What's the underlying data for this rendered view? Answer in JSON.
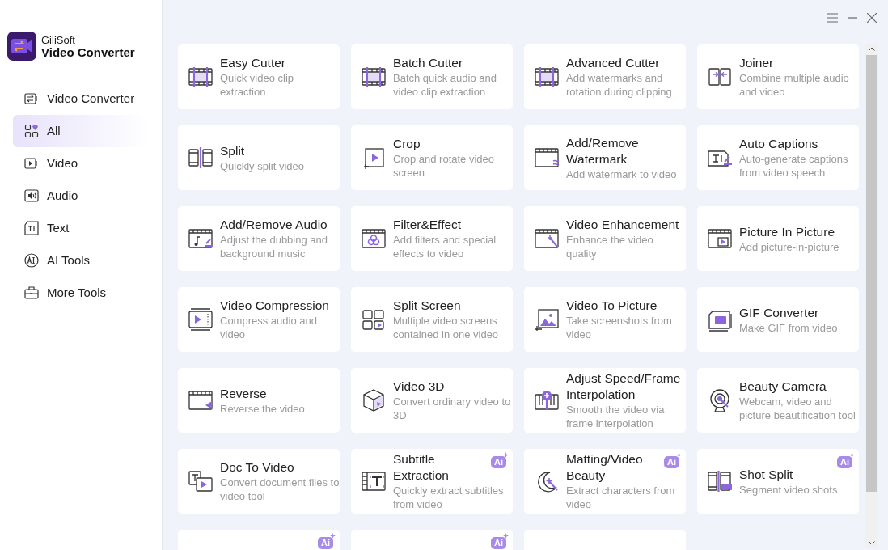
{
  "app": {
    "brand": "GiliSoft",
    "product": "Video Converter"
  },
  "sidebar": {
    "items": [
      {
        "label": "Video Converter",
        "selected": false
      },
      {
        "label": "All",
        "selected": true
      },
      {
        "label": "Video",
        "selected": false
      },
      {
        "label": "Audio",
        "selected": false
      },
      {
        "label": "Text",
        "selected": false
      },
      {
        "label": "AI Tools",
        "selected": false
      },
      {
        "label": "More Tools",
        "selected": false
      }
    ]
  },
  "tools": [
    {
      "title": "Easy Cutter",
      "description": "Quick video clip extraction"
    },
    {
      "title": "Batch Cutter",
      "description": "Batch quick audio and video clip extraction"
    },
    {
      "title": "Advanced Cutter",
      "description": "Add watermarks and rotation during clipping"
    },
    {
      "title": "Joiner",
      "description": "Combine multiple audio and video"
    },
    {
      "title": "Split",
      "description": "Quickly split video"
    },
    {
      "title": "Crop",
      "description": "Crop and rotate video screen"
    },
    {
      "title": "Add/Remove Watermark",
      "description": "Add watermark to video"
    },
    {
      "title": "Auto Captions",
      "description": "Auto-generate captions from video speech"
    },
    {
      "title": "Add/Remove Audio",
      "description": "Adjust the dubbing and background music"
    },
    {
      "title": "Filter&Effect",
      "description": "Add filters and special effects to video"
    },
    {
      "title": "Video Enhancement",
      "description": "Enhance the video quality"
    },
    {
      "title": "Picture In Picture",
      "description": "Add picture-in-picture"
    },
    {
      "title": "Video Compression",
      "description": "Compress audio and video"
    },
    {
      "title": "Split Screen",
      "description": "Multiple video screens contained in one video"
    },
    {
      "title": "Video To Picture",
      "description": "Take screenshots from video"
    },
    {
      "title": "GIF Converter",
      "description": "Make GIF from video"
    },
    {
      "title": "Reverse",
      "description": "Reverse the video"
    },
    {
      "title": "Video 3D",
      "description": "Convert ordinary video to 3D"
    },
    {
      "title": "Adjust Speed/Frame Interpolation",
      "description": "Smooth the video via frame interpolation"
    },
    {
      "title": "Beauty Camera",
      "description": "Webcam, video and picture beautification tool"
    },
    {
      "title": "Doc To Video",
      "description": "Convert document files to video tool"
    },
    {
      "title": "Subtitle Extraction",
      "description": "Quickly extract subtitles from video",
      "badge": "Ai"
    },
    {
      "title": "Matting/Video Beauty",
      "description": "Extract characters from video",
      "badge": "Ai"
    },
    {
      "title": "Shot Split",
      "description": "Segment video shots",
      "badge": "Ai"
    },
    {
      "badge": "Ai"
    },
    {
      "badge": "Ai"
    },
    {
      "kind": "plain"
    }
  ]
}
